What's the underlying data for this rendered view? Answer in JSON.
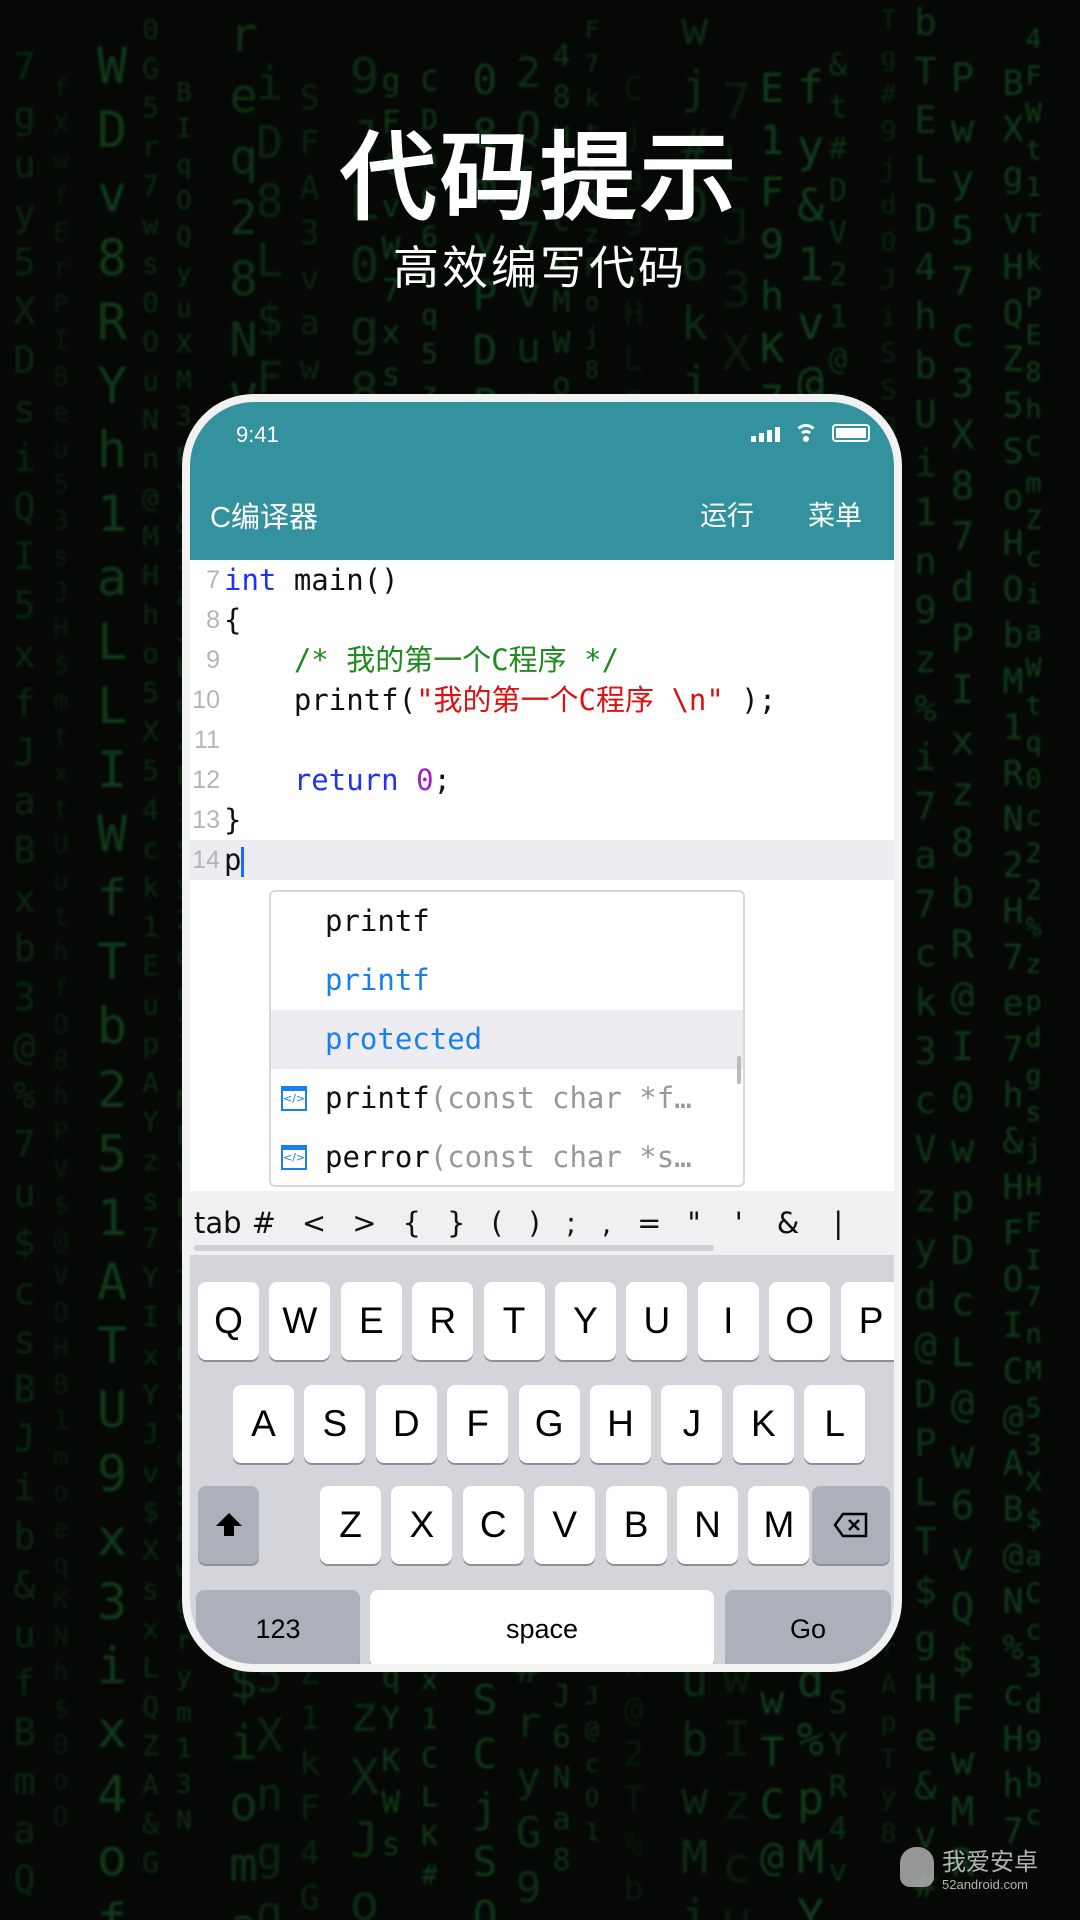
{
  "promo": {
    "headline": "代码提示",
    "subheadline": "高效编写代码"
  },
  "status_bar": {
    "time": "9:41"
  },
  "app_bar": {
    "title": "C编译器",
    "run_label": "运行",
    "menu_label": "菜单",
    "color": "#33929e"
  },
  "editor": {
    "lines": [
      {
        "num": "7",
        "parts": [
          {
            "t": "int",
            "c": "kw"
          },
          {
            "t": " main()",
            "c": ""
          }
        ]
      },
      {
        "num": "8",
        "parts": [
          {
            "t": "{",
            "c": ""
          }
        ]
      },
      {
        "num": "9",
        "parts": [
          {
            "t": "    /* 我的第一个C程序 */",
            "c": "cm"
          }
        ]
      },
      {
        "num": "10",
        "parts": [
          {
            "t": "    printf(",
            "c": ""
          },
          {
            "t": "\"我的第一个C程序 \\n\"",
            "c": "st"
          },
          {
            "t": " );",
            "c": ""
          }
        ]
      },
      {
        "num": "11",
        "parts": []
      },
      {
        "num": "12",
        "parts": [
          {
            "t": "    ",
            "c": ""
          },
          {
            "t": "return",
            "c": "kw"
          },
          {
            "t": " ",
            "c": ""
          },
          {
            "t": "0",
            "c": "nm"
          },
          {
            "t": ";",
            "c": ""
          }
        ]
      },
      {
        "num": "13",
        "parts": [
          {
            "t": "}",
            "c": ""
          }
        ]
      },
      {
        "num": "14",
        "parts": [
          {
            "t": "p",
            "c": ""
          }
        ],
        "active": true
      }
    ]
  },
  "autocomplete": [
    {
      "label": "printf",
      "style": "plain"
    },
    {
      "label": "printf",
      "style": "keyword"
    },
    {
      "label": "protected",
      "style": "keyword-selected"
    },
    {
      "label": "printf",
      "signature": "(const char *f…",
      "icon": "function-icon"
    },
    {
      "label": "perror",
      "signature": "(const char *s…",
      "icon": "function-icon"
    }
  ],
  "symbol_bar": [
    "tab",
    "#",
    "<",
    ">",
    "{",
    "}",
    "(",
    ")",
    ";",
    ",",
    "=",
    "\"",
    "'",
    "&",
    "|"
  ],
  "keyboard": {
    "row1": [
      "Q",
      "W",
      "E",
      "R",
      "T",
      "Y",
      "U",
      "I",
      "O",
      "P"
    ],
    "row2": [
      "A",
      "S",
      "D",
      "F",
      "G",
      "H",
      "J",
      "K",
      "L"
    ],
    "row3": [
      "Z",
      "X",
      "C",
      "V",
      "B",
      "N",
      "M"
    ],
    "numbers_label": "123",
    "space_label": "space",
    "go_label": "Go"
  },
  "watermark": {
    "name": "我爱安卓",
    "site": "52android.com"
  }
}
